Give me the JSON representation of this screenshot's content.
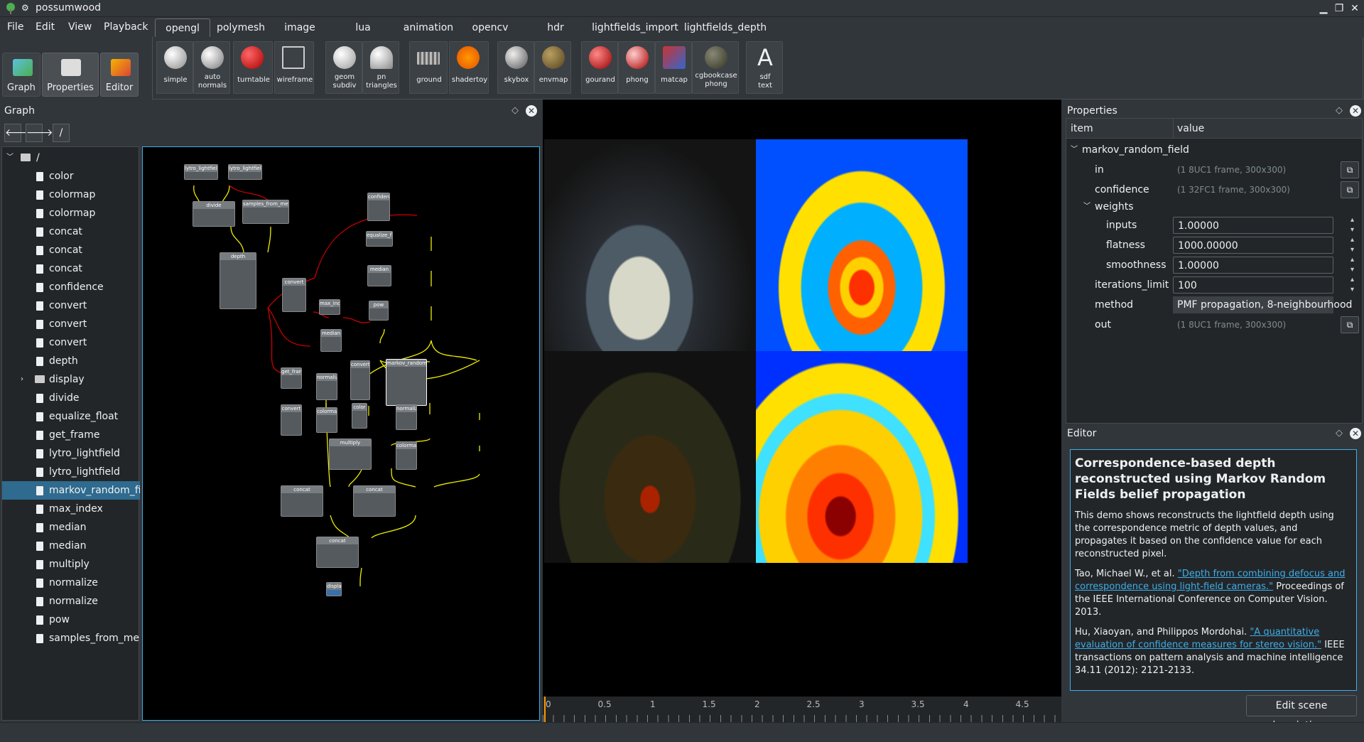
{
  "window": {
    "title": "possumwood"
  },
  "menubar": [
    "File",
    "Edit",
    "View",
    "Playback"
  ],
  "tabs": [
    "opengl",
    "polymesh",
    "image",
    "lua",
    "animation",
    "opencv",
    "hdr",
    "lightfields_import",
    "lightfields_depth"
  ],
  "tools": [
    "simple",
    "auto\nnormals",
    "turntable",
    "wireframe",
    "geom\nsubdiv",
    "pn\ntriangles",
    "ground",
    "shadertoy",
    "skybox",
    "envmap",
    "gourand",
    "phong",
    "matcap",
    "cgbookcase\nphong",
    "sdf\ntext"
  ],
  "left_buttons": [
    "Graph",
    "Properties",
    "Editor"
  ],
  "graph_dock": {
    "title": "Graph",
    "path": "/"
  },
  "tree": {
    "root": "/",
    "items": [
      "color",
      "colormap",
      "colormap",
      "concat",
      "concat",
      "concat",
      "confidence",
      "convert",
      "convert",
      "convert",
      "depth",
      "display",
      "divide",
      "equalize_float",
      "get_frame",
      "lytro_lightfield",
      "lytro_lightfield",
      "markov_random_fi...",
      "max_index",
      "median",
      "median",
      "multiply",
      "normalize",
      "normalize",
      "pow",
      "samples_from_me..."
    ]
  },
  "graph_nodes": [
    "lytro_lightfield",
    "lytro_lightfield",
    "divide",
    "samples_from_metadata",
    "depth",
    "convert",
    "max_index",
    "confidence",
    "equalize_float",
    "median",
    "pow",
    "median",
    "get_frame",
    "normalize",
    "convert",
    "markov_random_field",
    "convert",
    "colormap",
    "color",
    "normalize",
    "multiply",
    "colormap",
    "concat",
    "concat",
    "concat",
    "display"
  ],
  "timeline": [
    "0",
    "0.5",
    "1",
    "1.5",
    "2",
    "2.5",
    "3",
    "3.5",
    "4",
    "4.5"
  ],
  "properties": {
    "title": "Properties",
    "col_item": "item",
    "col_value": "value",
    "node": "markov_random_field",
    "rows": [
      {
        "name": "in",
        "value": "(1 8UC1 frame, 300x300)"
      },
      {
        "name": "confidence",
        "value": "(1 32FC1 frame, 300x300)"
      },
      {
        "name": "weights",
        "value": ""
      },
      {
        "name": "inputs",
        "value": "1.00000"
      },
      {
        "name": "flatness",
        "value": "1000.00000"
      },
      {
        "name": "smoothness",
        "value": "1.00000"
      },
      {
        "name": "iterations_limit",
        "value": "100"
      },
      {
        "name": "method",
        "value": "PMF propagation, 8-neighbourhood"
      },
      {
        "name": "out",
        "value": "(1 8UC1 frame, 300x300)"
      }
    ]
  },
  "editor": {
    "title": "Editor",
    "heading": "Correspondence-based depth reconstructed using Markov Random Fields belief propagation",
    "p1": "This demo shows reconstructs the lightfield depth using the correspondence metric of depth values, and propagates it based on the confidence value for each reconstructed pixel.",
    "p2_pre": "Tao, Michael W., et al. ",
    "p2_link": "\"Depth from combining defocus and correspondence using light-field cameras.\"",
    "p2_post": " Proceedings of the IEEE International Conference on Computer Vision. 2013.",
    "p3_pre": "Hu, Xiaoyan, and Philippos Mordohai. ",
    "p3_link": "\"A quantitative evaluation of confidence measures for stereo vision.\"",
    "p3_post": " IEEE transactions on pattern analysis and machine intelligence 34.11 (2012): 2121-2133.",
    "button": "Edit scene description..."
  },
  "colors": {
    "accent": "#3daee9",
    "bg": "#31363b",
    "panel": "#232629"
  }
}
